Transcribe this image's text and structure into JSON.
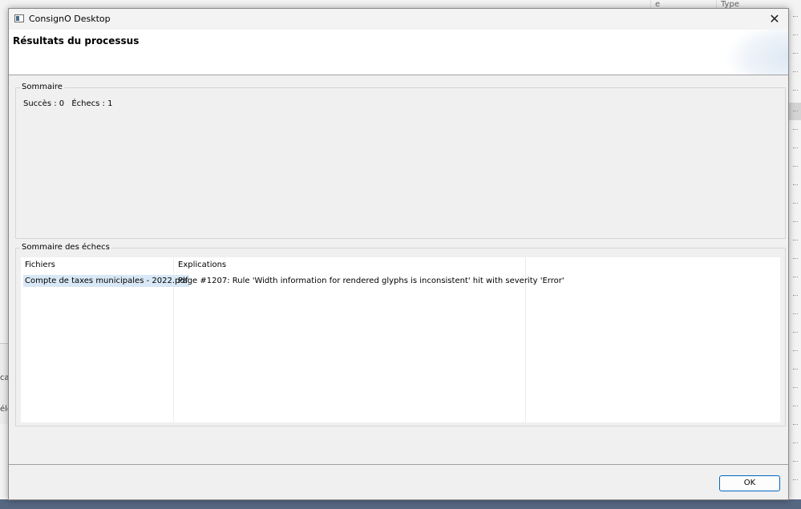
{
  "background_app": {
    "column_headers": [
      "e",
      "Type"
    ],
    "left_texts": [
      "cal",
      "élé"
    ]
  },
  "dialog": {
    "title": "ConsignO Desktop",
    "close_glyph": "✕",
    "header_title": "Résultats du processus",
    "summary": {
      "group_label": "Sommaire",
      "success_text": "Succès : 0",
      "failure_text": "Échecs : 1"
    },
    "failures": {
      "group_label": "Sommaire des échecs",
      "columns": [
        "Fichiers",
        "Explications",
        ""
      ],
      "rows": [
        {
          "file": "Compte de taxes municipales - 2022.pdf",
          "explanation": "Page #1207: Rule 'Width information for rendered glyphs is inconsistent' hit with severity 'Error'"
        }
      ]
    },
    "ok_label": "OK"
  },
  "colors": {
    "accent": "#0067c0",
    "selection": "#d9e8f6",
    "dialog_bg": "#f0f0f0"
  }
}
